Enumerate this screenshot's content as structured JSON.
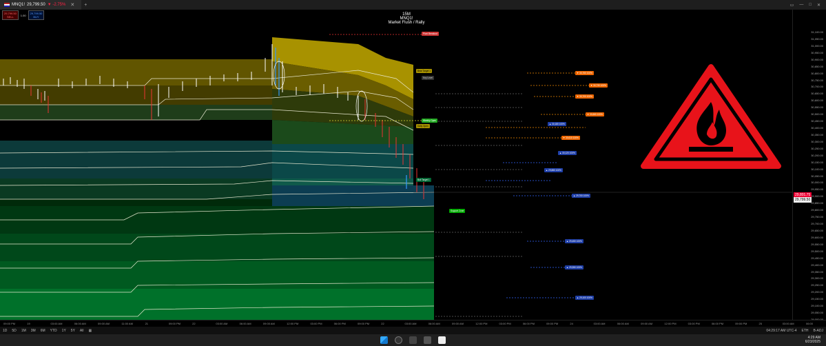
{
  "tab": {
    "symbol": "MNQ1!",
    "price": "29,799.50",
    "change": "▼ -2.75%"
  },
  "tabbar_icons": [
    "window-icon",
    "minimize-icon",
    "maximize-icon",
    "close-icon"
  ],
  "quote": {
    "sell_price": "29,799.50",
    "sell_label": "SELL",
    "mid": "1.00",
    "buy_price": "29,799.50",
    "buy_label": "BUY"
  },
  "chart_title": {
    "interval": "15M",
    "symbol": "MNQ1!",
    "subtitle": "Market Flush / Rally"
  },
  "price_scale": [
    "31,100.00",
    "31,050.00",
    "31,000.00",
    "30,950.00",
    "30,900.00",
    "30,850.00",
    "30,800.00",
    "30,750.00",
    "30,700.00",
    "30,650.00",
    "30,600.00",
    "30,550.00",
    "30,500.00",
    "30,450.00",
    "30,400.00",
    "30,350.00",
    "30,300.00",
    "30,250.00",
    "30,200.00",
    "30,150.00",
    "30,100.00",
    "30,050.00",
    "30,000.00",
    "29,950.00",
    "29,900.00",
    "29,850.00",
    "29,800.00",
    "29,750.00",
    "29,700.00",
    "29,650.00",
    "29,600.00",
    "29,550.00",
    "29,500.00",
    "29,450.00",
    "29,400.00",
    "29,350.00",
    "29,300.00",
    "29,250.00",
    "29,200.00",
    "29,150.00",
    "29,100.00",
    "29,050.00",
    "29,000.00"
  ],
  "current_price_label": "29,801.75",
  "current_price_label2": "29,799.50",
  "time_labels": [
    "09:00 PM",
    "19",
    "03:00 AM",
    "06:00 AM",
    "09:00 AM",
    "11:00 AM",
    "21",
    "09:00 PM",
    "22",
    "03:00 AM",
    "06:00 AM",
    "09:00 AM",
    "12:00 PM",
    "03:00 PM",
    "06:00 PM",
    "09:00 PM",
    "22",
    "03:00 AM",
    "06:00 AM",
    "09:00 AM",
    "12:00 PM",
    "03:00 PM",
    "06:00 PM",
    "09:00 PM",
    "24",
    "03:00 AM",
    "06:00 AM",
    "09:00 AM",
    "12:00 PM",
    "03:00 PM",
    "06:00 PM",
    "09:00 PM",
    "25",
    "03:00 AM",
    "06:00"
  ],
  "bottom_bar": {
    "ranges": [
      "1D",
      "5D",
      "1M",
      "3M",
      "6M",
      "YTD",
      "1Y",
      "5Y",
      "All"
    ],
    "time": "04:29:17 AM UTC-4",
    "session": "ETH",
    "adj": "B-ADJ"
  },
  "taskbar": {
    "time": "4:29 AM",
    "date": "6/23/2025"
  },
  "levels_left": [
    "Pivot Breakout",
    "Bear Target 1",
    "Key Level",
    "Weekly Open",
    "Daily Open",
    "Bull Target 1",
    "Support Zone"
  ],
  "levels_right": [
    "▼ 30,760 100%",
    "▼ 30,730 100%",
    "▼ 30,700 100%",
    "▼ 30,660 100%",
    "▼ 30,610 100%",
    "▲ 30,180 100%",
    "▲ 30,120 100%",
    "▲ 29,880 100%",
    "▲ 29,700 100%",
    "▲ 29,450 100%",
    "▲ 29,350 100%",
    "▲ 29,100 100%"
  ]
}
